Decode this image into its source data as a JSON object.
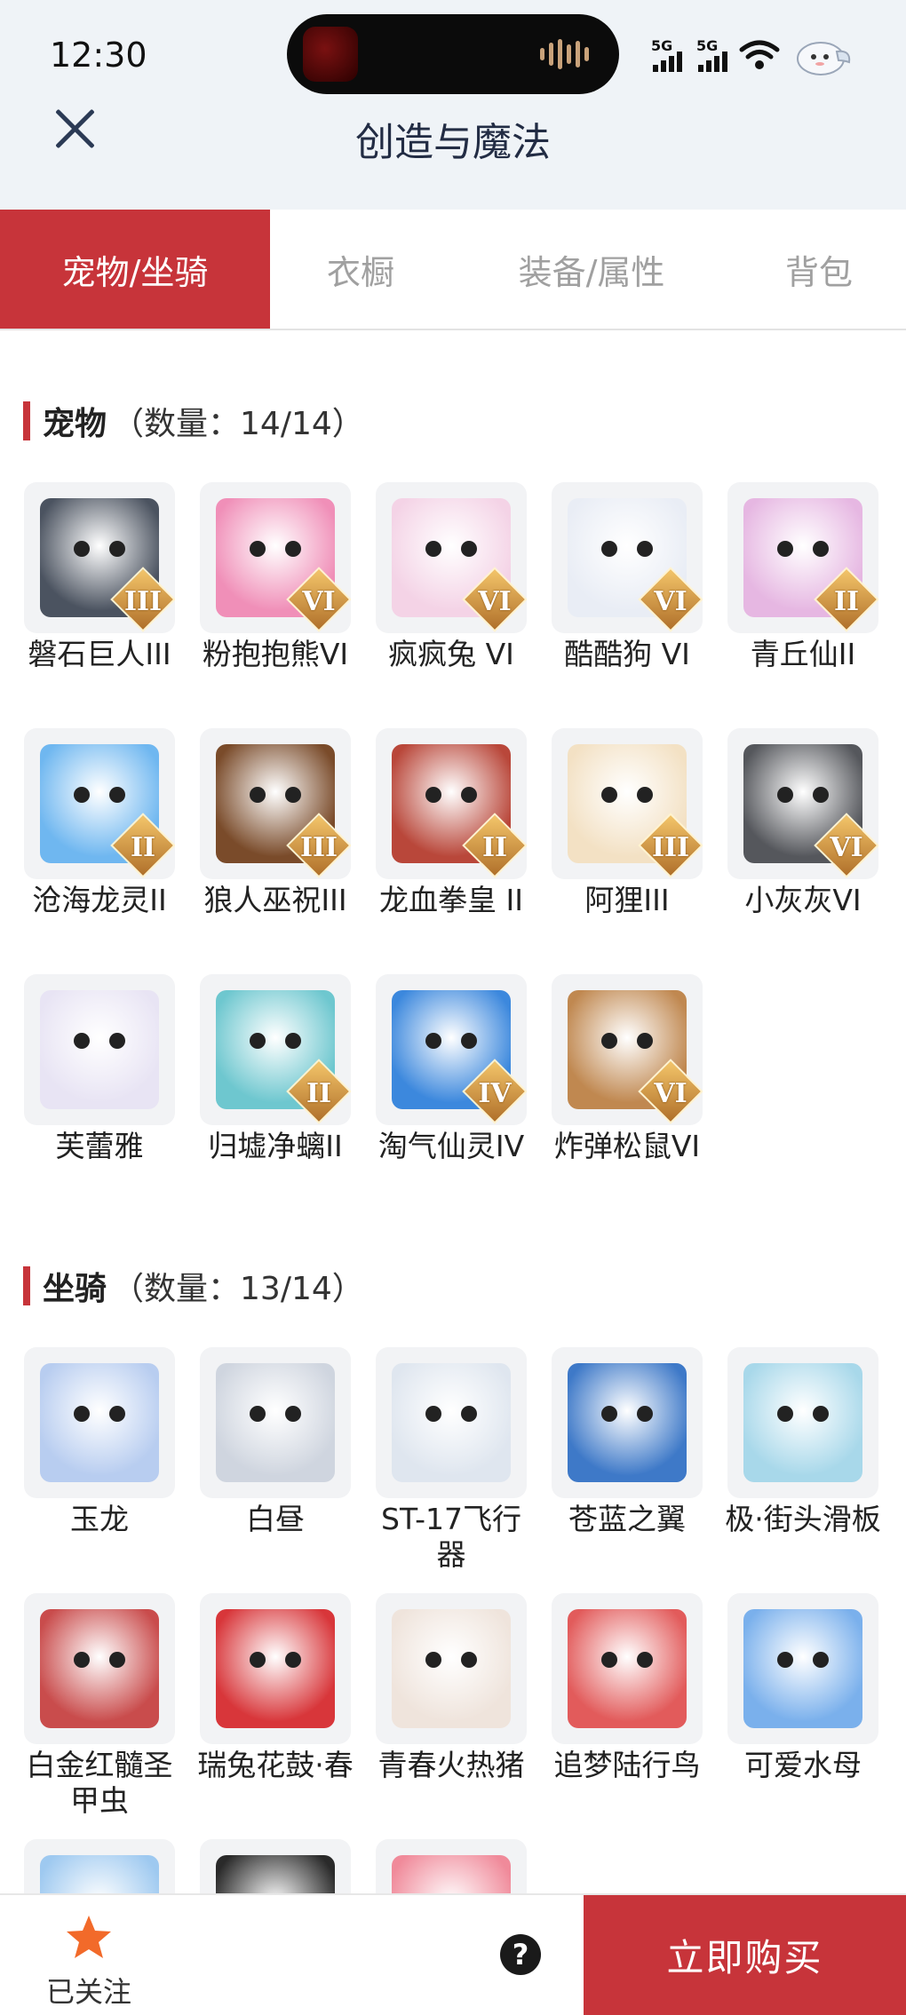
{
  "status_bar": {
    "time": "12:30",
    "network_1": "5G",
    "network_2": "5G"
  },
  "header": {
    "title": "创造与魔法"
  },
  "tabs": [
    {
      "label": "宠物/坐骑",
      "active": true
    },
    {
      "label": "衣橱",
      "active": false
    },
    {
      "label": "装备/属性",
      "active": false
    },
    {
      "label": "背包",
      "active": false
    }
  ],
  "pets": {
    "title": "宠物",
    "count": "（数量：14/14）",
    "items": [
      {
        "name": "磐石巨人III",
        "badge": "III",
        "color": "#4b5360"
      },
      {
        "name": "粉抱抱熊VI",
        "badge": "VI",
        "color": "#f08fb8"
      },
      {
        "name": "疯疯兔 VI",
        "badge": "VI",
        "color": "#f4d3e6"
      },
      {
        "name": "酷酷狗 VI",
        "badge": "VI",
        "color": "#e9edf5"
      },
      {
        "name": "青丘仙II",
        "badge": "II",
        "color": "#e6b7e2"
      },
      {
        "name": "沧海龙灵II",
        "badge": "II",
        "color": "#6fb7f0"
      },
      {
        "name": "狼人巫祝III",
        "badge": "III",
        "color": "#7a4b2a"
      },
      {
        "name": "龙血拳皇 II",
        "badge": "II",
        "color": "#b9473a"
      },
      {
        "name": "阿狸III",
        "badge": "III",
        "color": "#f3e1c4"
      },
      {
        "name": "小灰灰VI",
        "badge": "VI",
        "color": "#55575c"
      },
      {
        "name": "芙蕾雅",
        "badge": "",
        "color": "#e8e4f4"
      },
      {
        "name": "归墟净螭II",
        "badge": "II",
        "color": "#6ec7cf"
      },
      {
        "name": "淘气仙灵IV",
        "badge": "IV",
        "color": "#3c88dd"
      },
      {
        "name": "炸弹松鼠VI",
        "badge": "VI",
        "color": "#c08850"
      }
    ]
  },
  "mounts": {
    "title": "坐骑",
    "count": "（数量：13/14）",
    "items": [
      {
        "name": "玉龙",
        "color": "#b8cdf0"
      },
      {
        "name": "白昼",
        "color": "#cfd5df"
      },
      {
        "name": "ST-17飞行器",
        "color": "#dfe6ef"
      },
      {
        "name": "苍蓝之翼",
        "color": "#3e79c8"
      },
      {
        "name": "极·街头滑板",
        "color": "#a8d8ea"
      },
      {
        "name": "白金红髓圣甲虫",
        "color": "#c94c4c"
      },
      {
        "name": "瑞兔花鼓·春",
        "color": "#d8363a"
      },
      {
        "name": "青春火热猪",
        "color": "#efe4dc"
      },
      {
        "name": "追梦陆行鸟",
        "color": "#e25b5b"
      },
      {
        "name": "可爱水母",
        "color": "#7ab0ec"
      },
      {
        "name": "",
        "color": "#9ec9f0"
      },
      {
        "name": "",
        "color": "#2a2a2a"
      },
      {
        "name": "",
        "color": "#f08a9a"
      }
    ]
  },
  "bottom_bar": {
    "follow_label": "已关注",
    "help_symbol": "?",
    "buy_label": "立即购买"
  }
}
